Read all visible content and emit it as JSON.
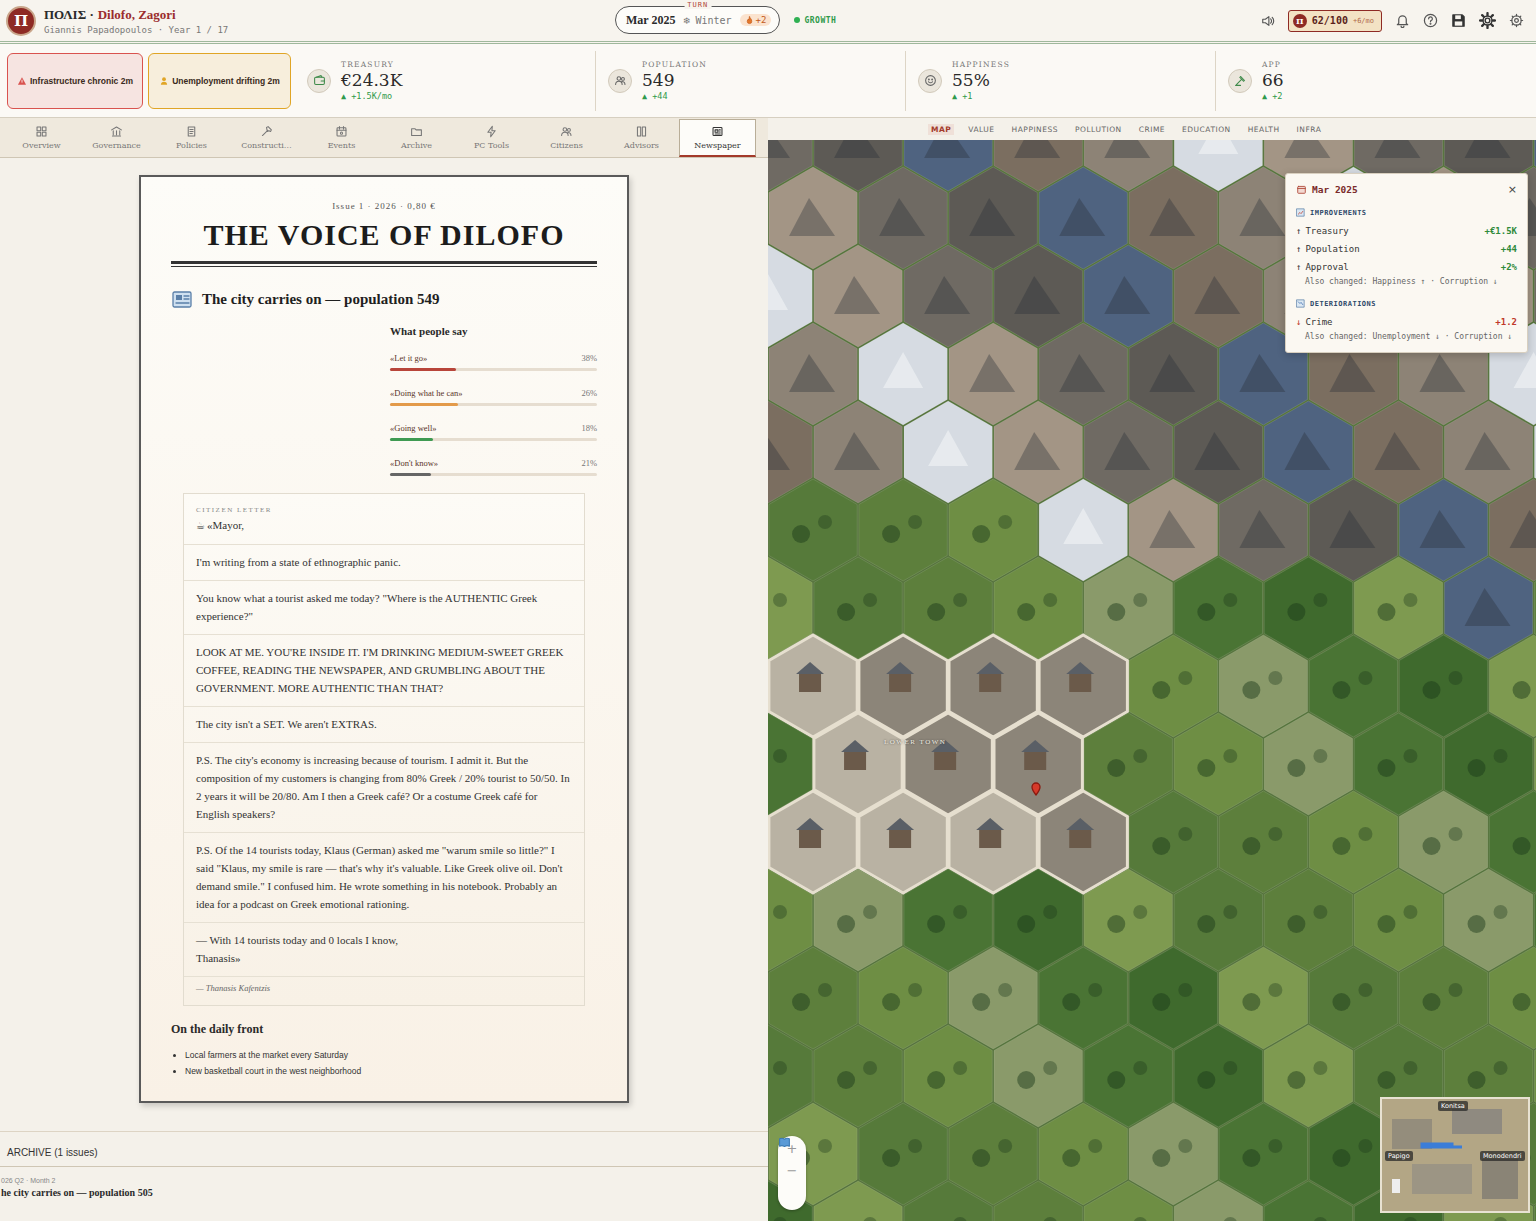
{
  "header": {
    "logo": "Π",
    "brand": "ΠΟΛΙΣ ·",
    "city": "Dilofo, Zagori",
    "subtitle": "Giannis Papadopoulos · Year 1 / 17"
  },
  "turn": {
    "label": "TURN",
    "date": "Mar 2025",
    "season": "❄ Winter",
    "heat": "+2",
    "status": "GROWTH"
  },
  "points": {
    "logo": "Π",
    "value": "62/100",
    "rate": "+6/mo"
  },
  "alerts": [
    {
      "label": "Infrastructure chronic 2m",
      "color": "#d9534f"
    },
    {
      "label": "Unemployment drifting 2m",
      "color": "#e0a526"
    }
  ],
  "stats": [
    {
      "label": "TREASURY",
      "value": "€24.3K",
      "delta": "▲ +1.5K/mo"
    },
    {
      "label": "POPULATION",
      "value": "549",
      "delta": "▲ +44"
    },
    {
      "label": "HAPPINESS",
      "value": "55%",
      "delta": "▲ +1"
    },
    {
      "label": "APP",
      "value": "66",
      "delta": "▲ +2"
    }
  ],
  "tabs": [
    {
      "label": "Overview",
      "selected": false
    },
    {
      "label": "Governance",
      "selected": false
    },
    {
      "label": "Policies",
      "selected": false
    },
    {
      "label": "Constructi…",
      "selected": false
    },
    {
      "label": "Events",
      "selected": false
    },
    {
      "label": "Archive",
      "selected": false
    },
    {
      "label": "PC Tools",
      "selected": false
    },
    {
      "label": "Citizens",
      "selected": false
    },
    {
      "label": "Advisors",
      "selected": false
    },
    {
      "label": "Newspaper",
      "selected": true
    }
  ],
  "newspaper": {
    "issue": "Issue 1 · 2026 · 0,80 €",
    "title": "THE VOICE OF DILOFO",
    "headline": "The city carries on — population 549",
    "poll": {
      "title": "What people say",
      "options": [
        {
          "label": "«Let it go»",
          "percent": "38%",
          "level": 0.32,
          "color": "#b8453a"
        },
        {
          "label": "«Doing what he can»",
          "percent": "26%",
          "level": 0.33,
          "color": "#e39a4a"
        },
        {
          "label": "«Going well»",
          "percent": "18%",
          "level": 0.21,
          "color": "#3f9a52"
        },
        {
          "label": "«Don't know»",
          "percent": "21%",
          "level": 0.2,
          "color": "#666666"
        }
      ]
    },
    "letter": {
      "heading": "CITIZEN LETTER",
      "icon": "☕",
      "greeting": "«Mayor,",
      "paragraphs": [
        "I'm writing from a state of ethnographic panic.",
        "You know what a tourist asked me today? \"Where is the AUTHENTIC Greek experience?\"",
        "LOOK AT ME. YOU'RE INSIDE IT. I'M DRINKING MEDIUM-SWEET GREEK COFFEE, READING THE NEWSPAPER, AND GRUMBLING ABOUT THE GOVERNMENT. MORE AUTHENTIC THAN THAT?",
        "The city isn't a SET. We aren't EXTRAS.",
        "P.S. The city's economy is increasing because of tourism. I admit it. But the composition of my customers is changing from 80% Greek / 20% tourist to 50/50. In 2 years it will be 20/80. Am I then a Greek café? Or a costume Greek café for English speakers?",
        "P.S. Of the 14 tourists today, Klaus (German) asked me \"warum smile so little?\" I said \"Klaus, my smile is rare — that's why it's valuable. Like Greek olive oil. Don't demand smile.\" I confused him. He wrote something in his notebook. Probably an idea for a podcast on Greek emotional rationing."
      ],
      "closing": [
        "— With 14 tourists today and 0 locals I know,",
        "Thanasis»"
      ],
      "signature": "— Thanasis Kafentzis"
    },
    "daily": {
      "title": "On the daily front",
      "items": [
        "Local farmers at the market every Saturday",
        "New basketball court in the west neighborhood"
      ]
    }
  },
  "archive": {
    "title": "ARCHIVE (1 issues)",
    "items": [
      {
        "meta": "026 Q2 · Month 2",
        "title": "he city carries on — population 505"
      }
    ]
  },
  "map": {
    "layers": [
      {
        "label": "MAP",
        "selected": true
      },
      {
        "label": "VALUE",
        "selected": false
      },
      {
        "label": "HAPPINESS",
        "selected": false
      },
      {
        "label": "POLLUTION",
        "selected": false
      },
      {
        "label": "CRIME",
        "selected": false
      },
      {
        "label": "EDUCATION",
        "selected": false
      },
      {
        "label": "HEALTH",
        "selected": false
      },
      {
        "label": "INFRA",
        "selected": false
      }
    ],
    "region": "LOWER TOWN",
    "zoom": [
      "+",
      "−"
    ],
    "minimap": [
      "Konitsa",
      "Papigo",
      "Monodendri"
    ]
  },
  "popover": {
    "date": "Mar 2025",
    "close": "×",
    "sections": [
      {
        "title": "IMPROVEMENTS",
        "kind": "improvement",
        "rows": [
          {
            "arrow": "↑",
            "label": "Treasury",
            "value": "+€1.5K"
          },
          {
            "arrow": "↑",
            "label": "Population",
            "value": "+44"
          },
          {
            "arrow": "↑",
            "label": "Approval",
            "value": "+2%",
            "note": "Also changed: Happiness ↑ · Corruption ↓"
          }
        ]
      },
      {
        "title": "DETERIORATIONS",
        "kind": "deterioration",
        "rows": [
          {
            "arrow": "↓",
            "label": "Crime",
            "value": "+1.2",
            "note": "Also changed: Unemployment ↓ · Corruption ↓"
          }
        ]
      }
    ]
  }
}
